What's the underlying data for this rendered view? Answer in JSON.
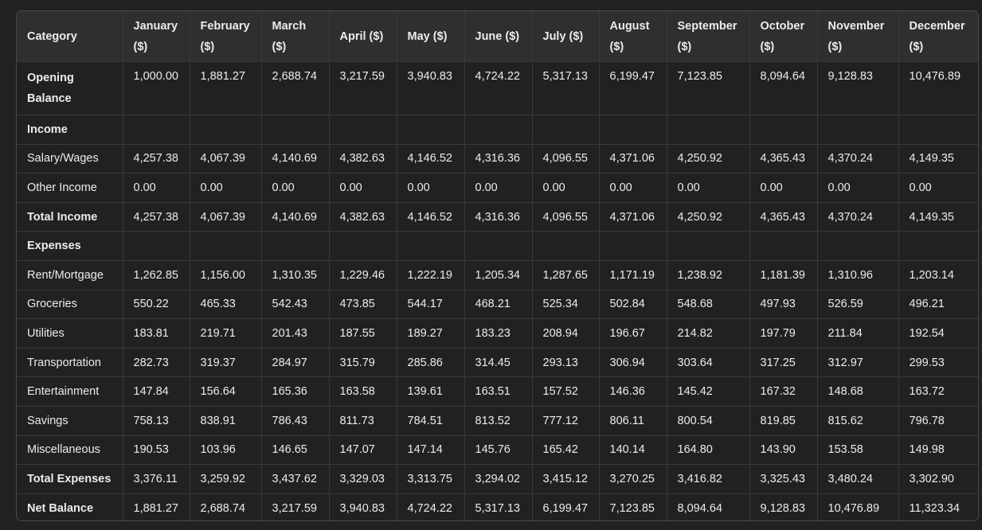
{
  "table": {
    "headers": [
      "Category",
      "January ($)",
      "February ($)",
      "March ($)",
      "April ($)",
      "May ($)",
      "June ($)",
      "July ($)",
      "August ($)",
      "September ($)",
      "October ($)",
      "November ($)",
      "December ($)"
    ],
    "rows": [
      {
        "label": "Opening Balance",
        "bold": true,
        "values": [
          "1,000.00",
          "1,881.27",
          "2,688.74",
          "3,217.59",
          "3,940.83",
          "4,724.22",
          "5,317.13",
          "6,199.47",
          "7,123.85",
          "8,094.64",
          "9,128.83",
          "10,476.89"
        ]
      },
      {
        "label": "Income",
        "bold": true,
        "values": [
          "",
          "",
          "",
          "",
          "",
          "",
          "",
          "",
          "",
          "",
          "",
          ""
        ]
      },
      {
        "label": "Salary/Wages",
        "bold": false,
        "values": [
          "4,257.38",
          "4,067.39",
          "4,140.69",
          "4,382.63",
          "4,146.52",
          "4,316.36",
          "4,096.55",
          "4,371.06",
          "4,250.92",
          "4,365.43",
          "4,370.24",
          "4,149.35"
        ]
      },
      {
        "label": "Other Income",
        "bold": false,
        "values": [
          "0.00",
          "0.00",
          "0.00",
          "0.00",
          "0.00",
          "0.00",
          "0.00",
          "0.00",
          "0.00",
          "0.00",
          "0.00",
          "0.00"
        ]
      },
      {
        "label": "Total Income",
        "bold": true,
        "values": [
          "4,257.38",
          "4,067.39",
          "4,140.69",
          "4,382.63",
          "4,146.52",
          "4,316.36",
          "4,096.55",
          "4,371.06",
          "4,250.92",
          "4,365.43",
          "4,370.24",
          "4,149.35"
        ]
      },
      {
        "label": "Expenses",
        "bold": true,
        "values": [
          "",
          "",
          "",
          "",
          "",
          "",
          "",
          "",
          "",
          "",
          "",
          ""
        ]
      },
      {
        "label": "Rent/Mortgage",
        "bold": false,
        "values": [
          "1,262.85",
          "1,156.00",
          "1,310.35",
          "1,229.46",
          "1,222.19",
          "1,205.34",
          "1,287.65",
          "1,171.19",
          "1,238.92",
          "1,181.39",
          "1,310.96",
          "1,203.14"
        ]
      },
      {
        "label": "Groceries",
        "bold": false,
        "values": [
          "550.22",
          "465.33",
          "542.43",
          "473.85",
          "544.17",
          "468.21",
          "525.34",
          "502.84",
          "548.68",
          "497.93",
          "526.59",
          "496.21"
        ]
      },
      {
        "label": "Utilities",
        "bold": false,
        "values": [
          "183.81",
          "219.71",
          "201.43",
          "187.55",
          "189.27",
          "183.23",
          "208.94",
          "196.67",
          "214.82",
          "197.79",
          "211.84",
          "192.54"
        ]
      },
      {
        "label": "Transportation",
        "bold": false,
        "values": [
          "282.73",
          "319.37",
          "284.97",
          "315.79",
          "285.86",
          "314.45",
          "293.13",
          "306.94",
          "303.64",
          "317.25",
          "312.97",
          "299.53"
        ]
      },
      {
        "label": "Entertainment",
        "bold": false,
        "values": [
          "147.84",
          "156.64",
          "165.36",
          "163.58",
          "139.61",
          "163.51",
          "157.52",
          "146.36",
          "145.42",
          "167.32",
          "148.68",
          "163.72"
        ]
      },
      {
        "label": "Savings",
        "bold": false,
        "values": [
          "758.13",
          "838.91",
          "786.43",
          "811.73",
          "784.51",
          "813.52",
          "777.12",
          "806.11",
          "800.54",
          "819.85",
          "815.62",
          "796.78"
        ]
      },
      {
        "label": "Miscellaneous",
        "bold": false,
        "values": [
          "190.53",
          "103.96",
          "146.65",
          "147.07",
          "147.14",
          "145.76",
          "165.42",
          "140.14",
          "164.80",
          "143.90",
          "153.58",
          "149.98"
        ]
      },
      {
        "label": "Total Expenses",
        "bold": true,
        "values": [
          "3,376.11",
          "3,259.92",
          "3,437.62",
          "3,329.03",
          "3,313.75",
          "3,294.02",
          "3,415.12",
          "3,270.25",
          "3,416.82",
          "3,325.43",
          "3,480.24",
          "3,302.90"
        ]
      },
      {
        "label": "Net Balance",
        "bold": true,
        "values": [
          "1,881.27",
          "2,688.74",
          "3,217.59",
          "3,940.83",
          "4,724.22",
          "5,317.13",
          "6,199.47",
          "7,123.85",
          "8,094.64",
          "9,128.83",
          "10,476.89",
          "11,323.34"
        ]
      }
    ]
  }
}
